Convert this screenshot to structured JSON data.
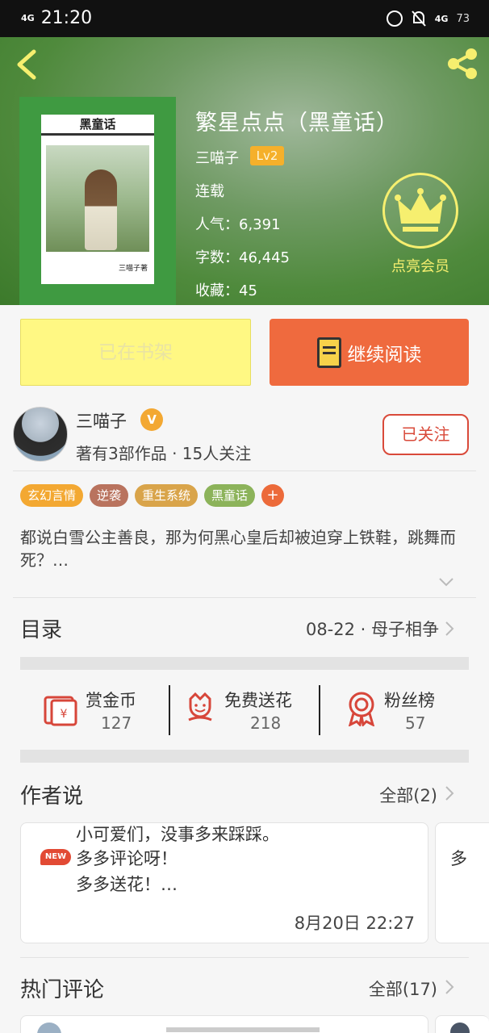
{
  "status_bar": {
    "signal": "4G",
    "time": "21:20",
    "network": "4G",
    "battery": "73"
  },
  "book": {
    "cover_title": "黑童话",
    "cover_author": "三喵子著",
    "title": "繁星点点（黑童话）",
    "author": "三喵子",
    "level": "Lv2",
    "status": "连载",
    "popularity": "人气：6,391",
    "words": "字数：46,445",
    "favorites": "收藏：45",
    "vip_label": "点亮会员"
  },
  "actions": {
    "shelf_label": "已在书架",
    "read_label": "继续阅读"
  },
  "author": {
    "name": "三喵子",
    "verified": "V",
    "stats": "著有3部作品 · 15人关注",
    "follow_label": "已关注"
  },
  "tags": [
    {
      "label": "玄幻言情",
      "color": "#f3a832"
    },
    {
      "label": "逆袭",
      "color": "#b9735e"
    },
    {
      "label": "重生系统",
      "color": "#d9a44a"
    },
    {
      "label": "黑童话",
      "color": "#8cb35a"
    }
  ],
  "summary": "都说白雪公主善良，那为何黑心皇后却被迫穿上铁鞋，跳舞而死？…",
  "catalog": {
    "title": "目录",
    "latest": "08-22 · 母子相争"
  },
  "stats": [
    {
      "label": "赏金币",
      "value": "127",
      "icon": "red-envelope-icon"
    },
    {
      "label": "免费送花",
      "value": "218",
      "icon": "flower-icon"
    },
    {
      "label": "粉丝榜",
      "value": "57",
      "icon": "award-ribbon-icon"
    }
  ],
  "author_says": {
    "title": "作者说",
    "more": "全部(2)",
    "new_badge": "NEW",
    "lines": [
      "小可爱们，没事多来踩踩。",
      "多多评论呀！",
      "多多送花！…"
    ],
    "time": "8月20日  22:27",
    "next_preview": "多"
  },
  "hot_comments": {
    "title": "热门评论",
    "more": "全部(17)"
  }
}
